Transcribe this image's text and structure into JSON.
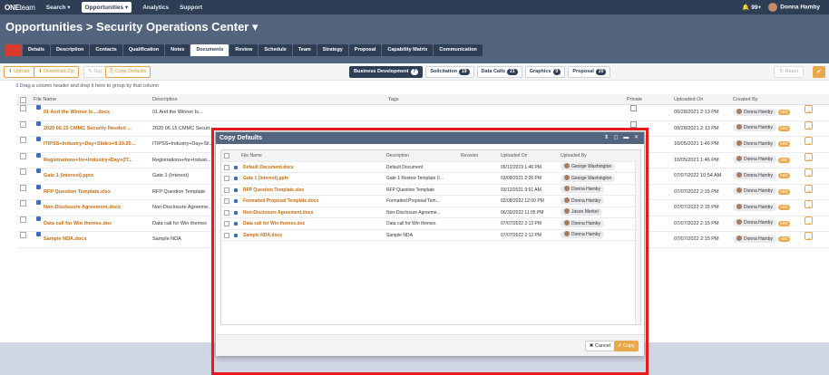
{
  "nav": {
    "logo_one": "ONE",
    "logo_team": "team",
    "items": [
      "Search ▾",
      "Opportunities ▾",
      "Analytics",
      "Support"
    ],
    "notifications": "🔔 99+",
    "user": "Donna Hamby"
  },
  "page_title": "Opportunities > Security Operations Center ▾",
  "tabs": [
    "Details",
    "Description",
    "Contacts",
    "Qualification",
    "Notes",
    "Documents",
    "Review",
    "Schedule",
    "Team",
    "Strategy",
    "Proposal",
    "Capability Matrix",
    "Communication"
  ],
  "active_tab": "Documents",
  "toolbar": {
    "upload": "⬆ Upload",
    "download_zip": "⬇ Download Zip",
    "tag": "✎ Tag",
    "copy_defaults": "⎘ Copy Defaults",
    "reset": "↻ Reset",
    "ok": "✔"
  },
  "filters": [
    {
      "label": "Business Development",
      "count": "7"
    },
    {
      "label": "Solicitation",
      "count": "19"
    },
    {
      "label": "Data Calls",
      "count": "21"
    },
    {
      "label": "Graphics",
      "count": "0"
    },
    {
      "label": "Proposal",
      "count": "20"
    }
  ],
  "group_hint": "Drag a column header and drop it here to group by that column",
  "grid": {
    "headers": {
      "file": "File Name",
      "desc": "Description",
      "tags": "Tags",
      "private": "Private",
      "uploaded": "Uploaded On",
      "created": "Created By"
    },
    "rows": [
      {
        "file": "01 And the Winner Is....docx",
        "desc": "01 And the Winner Is...",
        "date": "09/28/2021 2:13 PM",
        "by": "Donna Hamby",
        "tag": "ABC"
      },
      {
        "file": "2020 06.15 CMMC Security Needed ...",
        "desc": "2020 06.15 CMMC Securi...",
        "date": "09/28/2021 2:13 PM",
        "by": "Donna Hamby",
        "tag": "ABC"
      },
      {
        "file": "ITIPSS+Industry+Day+Slides+8.19.20...",
        "desc": "ITIPSS+Industry+Day+Sli...",
        "date": "10/05/2021 1:46 PM",
        "by": "Donna Hamby",
        "tag": "ABC"
      },
      {
        "file": "Registrations+for+Industry+Day+(IT...",
        "desc": "Registrations+for+Indust...",
        "date": "10/05/2021 1:46 PM",
        "by": "Donna Hamby",
        "tag": "ABC"
      },
      {
        "file": "Gate 1 (Interest).pptx",
        "desc": "Gate 1 (Interest)",
        "date": "07/07/2022 10:54 AM",
        "by": "Donna Hamby",
        "tag": "ABC"
      },
      {
        "file": "RFP Question Template.xlsx",
        "desc": "RFP Question Template",
        "date": "07/07/2022 2:15 PM",
        "by": "Donna Hamby",
        "tag": "ABC"
      },
      {
        "file": "Non-Disclosure Agreement.docx",
        "desc": "Non-Disclosure Agreeme...",
        "date": "07/07/2022 2:15 PM",
        "by": "Donna Hamby",
        "tag": "ABC"
      },
      {
        "file": "Data call for Win themes.doc",
        "desc": "Data call for Win themes",
        "date": "07/07/2022 2:15 PM",
        "by": "Donna Hamby",
        "tag": "ABC"
      },
      {
        "file": "Sample NDA.docx",
        "desc": "Sample NDA",
        "date": "07/07/2022 2:15 PM",
        "by": "Donna Hamby",
        "tag": "ABC"
      }
    ]
  },
  "modal": {
    "title": "Copy Defaults",
    "controls": "⇕ ◻ ▬ ✕",
    "headers": {
      "file": "File Name",
      "desc": "Description",
      "rev": "Revision",
      "uploaded": "Uploaded On",
      "by": "Uploaded By"
    },
    "rows": [
      {
        "file": "Default Document.docx",
        "desc": "Default Document",
        "date": "06/12/2019 1:46 PM",
        "by": "George Washington"
      },
      {
        "file": "Gate 1 (Interest).pptx",
        "desc": "Gate 1 Review Template (I...",
        "date": "03/08/2021 2:26 PM",
        "by": "George Washington"
      },
      {
        "file": "RFP Question Template.xlsx",
        "desc": "RFP Question Template",
        "date": "03/12/2021 9:51 AM",
        "by": "Donna Hamby"
      },
      {
        "file": "Formatted Proposal Template.docx",
        "desc": "Formatted Proposal Tem...",
        "date": "02/08/2022 12:00 PM",
        "by": "Donna Hamby"
      },
      {
        "file": "Non-Disclosure Agreement.docx",
        "desc": "Non-Disclosure Agreeme...",
        "date": "06/30/2022 11:05 PM",
        "by": "Jason Merkel"
      },
      {
        "file": "Data call for Win themes.doc",
        "desc": "Data call for Win themes",
        "date": "07/07/2022 2:12 PM",
        "by": "Donna Hamby"
      },
      {
        "file": "Sample NDA.docx",
        "desc": "Sample NDA",
        "date": "07/07/2022 2:12 PM",
        "by": "Donna Hamby"
      }
    ],
    "cancel": "✖ Cancel",
    "copy": "✔ Copy"
  }
}
